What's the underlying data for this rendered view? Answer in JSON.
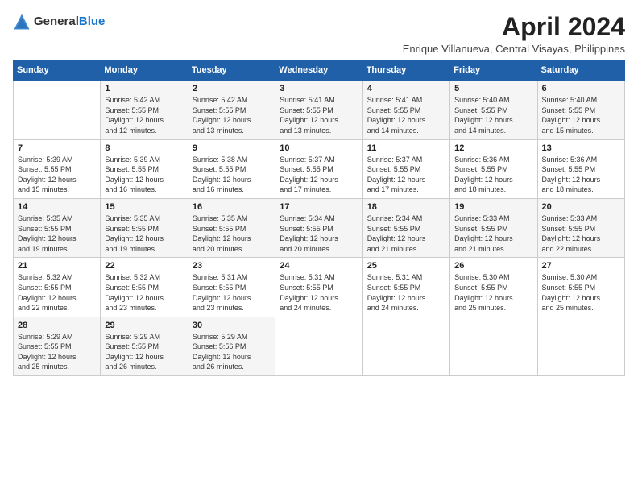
{
  "logo": {
    "general": "General",
    "blue": "Blue"
  },
  "title": "April 2024",
  "subtitle": "Enrique Villanueva, Central Visayas, Philippines",
  "days_header": [
    "Sunday",
    "Monday",
    "Tuesday",
    "Wednesday",
    "Thursday",
    "Friday",
    "Saturday"
  ],
  "weeks": [
    [
      {
        "day": "",
        "sunrise": "",
        "sunset": "",
        "daylight": ""
      },
      {
        "day": "1",
        "sunrise": "Sunrise: 5:42 AM",
        "sunset": "Sunset: 5:55 PM",
        "daylight": "Daylight: 12 hours and 12 minutes."
      },
      {
        "day": "2",
        "sunrise": "Sunrise: 5:42 AM",
        "sunset": "Sunset: 5:55 PM",
        "daylight": "Daylight: 12 hours and 13 minutes."
      },
      {
        "day": "3",
        "sunrise": "Sunrise: 5:41 AM",
        "sunset": "Sunset: 5:55 PM",
        "daylight": "Daylight: 12 hours and 13 minutes."
      },
      {
        "day": "4",
        "sunrise": "Sunrise: 5:41 AM",
        "sunset": "Sunset: 5:55 PM",
        "daylight": "Daylight: 12 hours and 14 minutes."
      },
      {
        "day": "5",
        "sunrise": "Sunrise: 5:40 AM",
        "sunset": "Sunset: 5:55 PM",
        "daylight": "Daylight: 12 hours and 14 minutes."
      },
      {
        "day": "6",
        "sunrise": "Sunrise: 5:40 AM",
        "sunset": "Sunset: 5:55 PM",
        "daylight": "Daylight: 12 hours and 15 minutes."
      }
    ],
    [
      {
        "day": "7",
        "sunrise": "Sunrise: 5:39 AM",
        "sunset": "Sunset: 5:55 PM",
        "daylight": "Daylight: 12 hours and 15 minutes."
      },
      {
        "day": "8",
        "sunrise": "Sunrise: 5:39 AM",
        "sunset": "Sunset: 5:55 PM",
        "daylight": "Daylight: 12 hours and 16 minutes."
      },
      {
        "day": "9",
        "sunrise": "Sunrise: 5:38 AM",
        "sunset": "Sunset: 5:55 PM",
        "daylight": "Daylight: 12 hours and 16 minutes."
      },
      {
        "day": "10",
        "sunrise": "Sunrise: 5:37 AM",
        "sunset": "Sunset: 5:55 PM",
        "daylight": "Daylight: 12 hours and 17 minutes."
      },
      {
        "day": "11",
        "sunrise": "Sunrise: 5:37 AM",
        "sunset": "Sunset: 5:55 PM",
        "daylight": "Daylight: 12 hours and 17 minutes."
      },
      {
        "day": "12",
        "sunrise": "Sunrise: 5:36 AM",
        "sunset": "Sunset: 5:55 PM",
        "daylight": "Daylight: 12 hours and 18 minutes."
      },
      {
        "day": "13",
        "sunrise": "Sunrise: 5:36 AM",
        "sunset": "Sunset: 5:55 PM",
        "daylight": "Daylight: 12 hours and 18 minutes."
      }
    ],
    [
      {
        "day": "14",
        "sunrise": "Sunrise: 5:35 AM",
        "sunset": "Sunset: 5:55 PM",
        "daylight": "Daylight: 12 hours and 19 minutes."
      },
      {
        "day": "15",
        "sunrise": "Sunrise: 5:35 AM",
        "sunset": "Sunset: 5:55 PM",
        "daylight": "Daylight: 12 hours and 19 minutes."
      },
      {
        "day": "16",
        "sunrise": "Sunrise: 5:35 AM",
        "sunset": "Sunset: 5:55 PM",
        "daylight": "Daylight: 12 hours and 20 minutes."
      },
      {
        "day": "17",
        "sunrise": "Sunrise: 5:34 AM",
        "sunset": "Sunset: 5:55 PM",
        "daylight": "Daylight: 12 hours and 20 minutes."
      },
      {
        "day": "18",
        "sunrise": "Sunrise: 5:34 AM",
        "sunset": "Sunset: 5:55 PM",
        "daylight": "Daylight: 12 hours and 21 minutes."
      },
      {
        "day": "19",
        "sunrise": "Sunrise: 5:33 AM",
        "sunset": "Sunset: 5:55 PM",
        "daylight": "Daylight: 12 hours and 21 minutes."
      },
      {
        "day": "20",
        "sunrise": "Sunrise: 5:33 AM",
        "sunset": "Sunset: 5:55 PM",
        "daylight": "Daylight: 12 hours and 22 minutes."
      }
    ],
    [
      {
        "day": "21",
        "sunrise": "Sunrise: 5:32 AM",
        "sunset": "Sunset: 5:55 PM",
        "daylight": "Daylight: 12 hours and 22 minutes."
      },
      {
        "day": "22",
        "sunrise": "Sunrise: 5:32 AM",
        "sunset": "Sunset: 5:55 PM",
        "daylight": "Daylight: 12 hours and 23 minutes."
      },
      {
        "day": "23",
        "sunrise": "Sunrise: 5:31 AM",
        "sunset": "Sunset: 5:55 PM",
        "daylight": "Daylight: 12 hours and 23 minutes."
      },
      {
        "day": "24",
        "sunrise": "Sunrise: 5:31 AM",
        "sunset": "Sunset: 5:55 PM",
        "daylight": "Daylight: 12 hours and 24 minutes."
      },
      {
        "day": "25",
        "sunrise": "Sunrise: 5:31 AM",
        "sunset": "Sunset: 5:55 PM",
        "daylight": "Daylight: 12 hours and 24 minutes."
      },
      {
        "day": "26",
        "sunrise": "Sunrise: 5:30 AM",
        "sunset": "Sunset: 5:55 PM",
        "daylight": "Daylight: 12 hours and 25 minutes."
      },
      {
        "day": "27",
        "sunrise": "Sunrise: 5:30 AM",
        "sunset": "Sunset: 5:55 PM",
        "daylight": "Daylight: 12 hours and 25 minutes."
      }
    ],
    [
      {
        "day": "28",
        "sunrise": "Sunrise: 5:29 AM",
        "sunset": "Sunset: 5:55 PM",
        "daylight": "Daylight: 12 hours and 25 minutes."
      },
      {
        "day": "29",
        "sunrise": "Sunrise: 5:29 AM",
        "sunset": "Sunset: 5:55 PM",
        "daylight": "Daylight: 12 hours and 26 minutes."
      },
      {
        "day": "30",
        "sunrise": "Sunrise: 5:29 AM",
        "sunset": "Sunset: 5:56 PM",
        "daylight": "Daylight: 12 hours and 26 minutes."
      },
      {
        "day": "",
        "sunrise": "",
        "sunset": "",
        "daylight": ""
      },
      {
        "day": "",
        "sunrise": "",
        "sunset": "",
        "daylight": ""
      },
      {
        "day": "",
        "sunrise": "",
        "sunset": "",
        "daylight": ""
      },
      {
        "day": "",
        "sunrise": "",
        "sunset": "",
        "daylight": ""
      }
    ]
  ]
}
